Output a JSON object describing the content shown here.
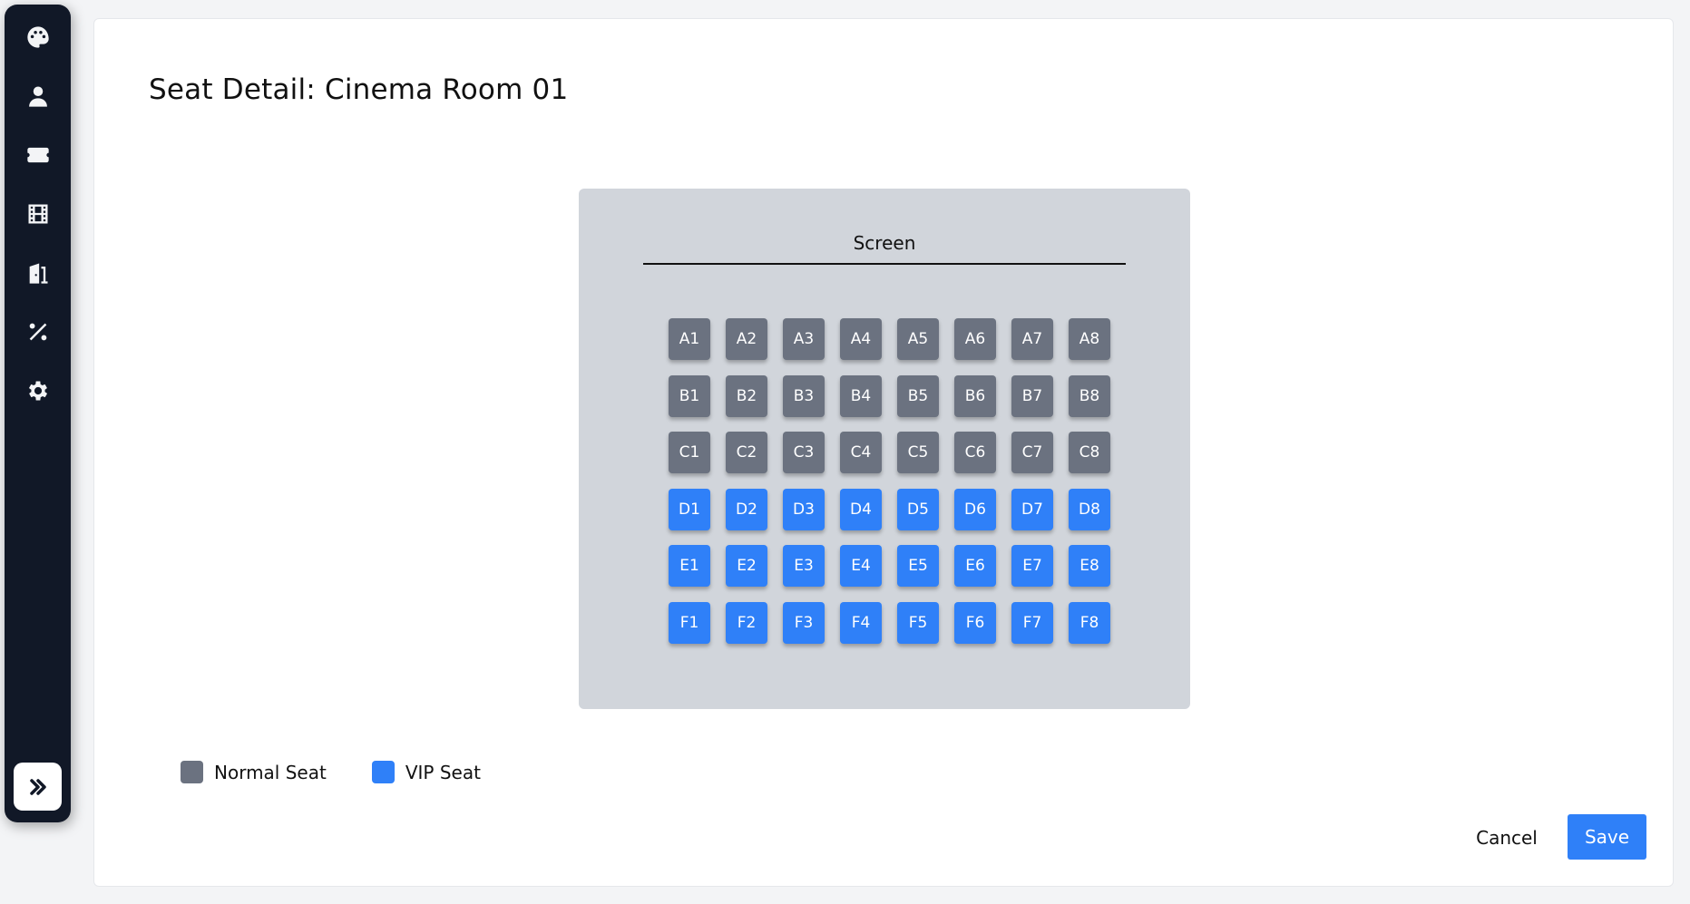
{
  "sidebar": {
    "items": [
      {
        "icon": "palette-icon"
      },
      {
        "icon": "user-icon"
      },
      {
        "icon": "ticket-icon"
      },
      {
        "icon": "film-icon"
      },
      {
        "icon": "door-icon"
      },
      {
        "icon": "percent-icon"
      },
      {
        "icon": "gear-icon"
      }
    ],
    "expand_icon": "double-chevron-right-icon"
  },
  "page": {
    "title": "Seat Detail: Cinema Room 01"
  },
  "room": {
    "screen_label": "Screen",
    "seat_colors": {
      "normal": "#6b7280",
      "vip": "#2f80f8"
    },
    "rows": [
      {
        "row": "A",
        "type": "normal",
        "seats": [
          "A1",
          "A2",
          "A3",
          "A4",
          "A5",
          "A6",
          "A7",
          "A8"
        ]
      },
      {
        "row": "B",
        "type": "normal",
        "seats": [
          "B1",
          "B2",
          "B3",
          "B4",
          "B5",
          "B6",
          "B7",
          "B8"
        ]
      },
      {
        "row": "C",
        "type": "normal",
        "seats": [
          "C1",
          "C2",
          "C3",
          "C4",
          "C5",
          "C6",
          "C7",
          "C8"
        ]
      },
      {
        "row": "D",
        "type": "vip",
        "seats": [
          "D1",
          "D2",
          "D3",
          "D4",
          "D5",
          "D6",
          "D7",
          "D8"
        ]
      },
      {
        "row": "E",
        "type": "vip",
        "seats": [
          "E1",
          "E2",
          "E3",
          "E4",
          "E5",
          "E6",
          "E7",
          "E8"
        ]
      },
      {
        "row": "F",
        "type": "vip",
        "seats": [
          "F1",
          "F2",
          "F3",
          "F4",
          "F5",
          "F6",
          "F7",
          "F8"
        ]
      }
    ]
  },
  "legend": {
    "normal_label": "Normal Seat",
    "vip_label": "VIP Seat"
  },
  "actions": {
    "cancel_label": "Cancel",
    "save_label": "Save"
  }
}
